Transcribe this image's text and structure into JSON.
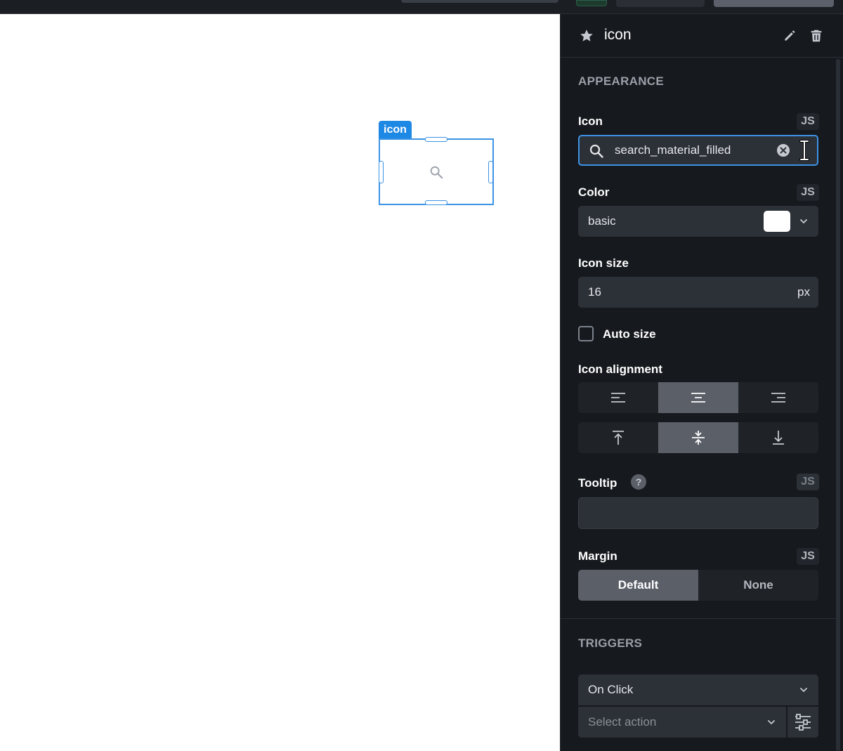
{
  "component": {
    "tag": "icon"
  },
  "panel": {
    "title": "icon",
    "appearance": {
      "section": "APPEARANCE",
      "icon": {
        "label": "Icon",
        "js": "JS",
        "value": "search_material_filled"
      },
      "color": {
        "label": "Color",
        "js": "JS",
        "value": "basic",
        "swatch": "#ffffff"
      },
      "icon_size": {
        "label": "Icon size",
        "value": "16",
        "unit": "px"
      },
      "auto_size": {
        "label": "Auto size",
        "checked": false
      },
      "alignment": {
        "label": "Icon alignment",
        "horizontal": [
          "align-left",
          "align-center",
          "align-right"
        ],
        "horizontal_selected": "align-center",
        "vertical": [
          "align-top",
          "align-middle",
          "align-bottom"
        ],
        "vertical_selected": "align-middle"
      },
      "tooltip": {
        "label": "Tooltip",
        "help": "?",
        "js": "JS",
        "value": ""
      },
      "margin": {
        "label": "Margin",
        "js": "JS",
        "options": [
          "Default",
          "None"
        ],
        "selected": "Default"
      }
    },
    "triggers": {
      "section": "TRIGGERS",
      "event": "On Click",
      "action_placeholder": "Select action"
    }
  },
  "colors": {
    "accent": "#3d93e6",
    "panel_bg": "#16191e",
    "tag_bg": "#1e88e5"
  }
}
